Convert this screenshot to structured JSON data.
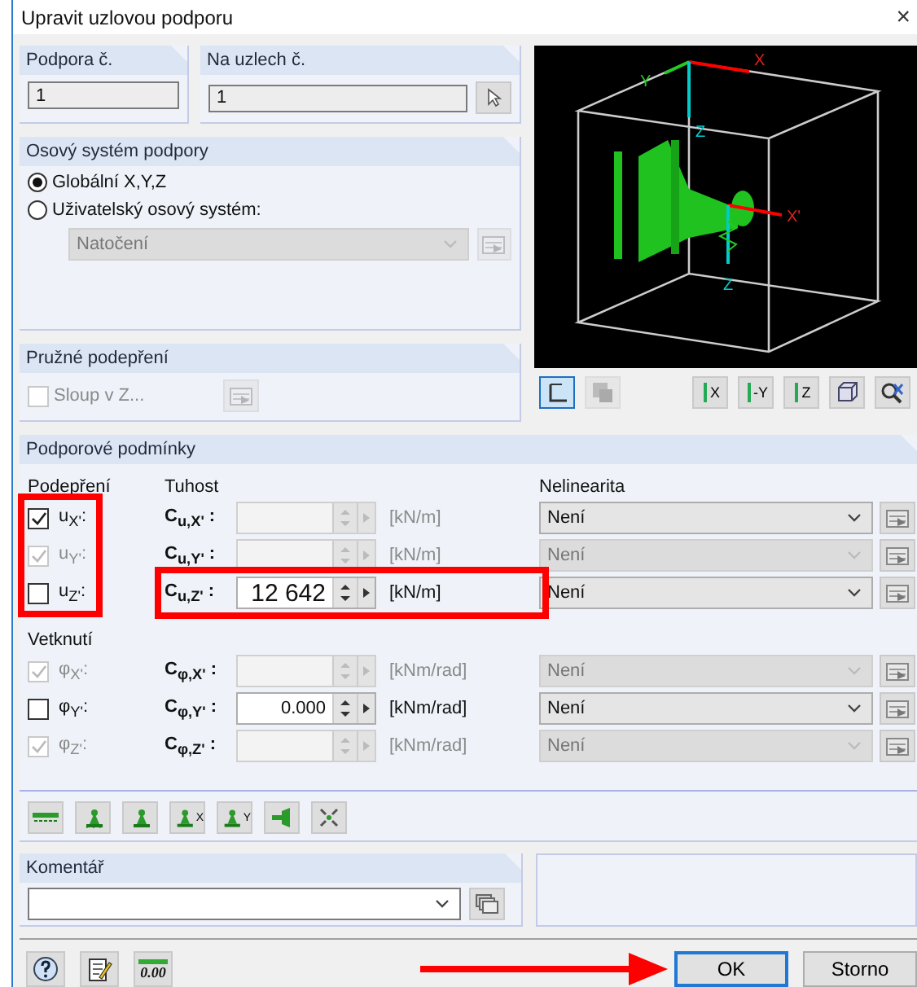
{
  "window": {
    "title": "Upravit uzlovou podporu",
    "close": "×"
  },
  "support_no": {
    "label": "Podpora č.",
    "value": "1"
  },
  "nodes": {
    "label": "Na uzlech č.",
    "value": "1"
  },
  "axis_system": {
    "title": "Osový systém podpory",
    "options": [
      {
        "label": "Globální X,Y,Z",
        "selected": true
      },
      {
        "label": "Uživatelský osový systém:",
        "selected": false
      }
    ],
    "rotation": {
      "value": "Natočení",
      "disabled": true
    }
  },
  "elastic": {
    "title": "Pružné podepření",
    "column": {
      "label": "Sloup v Z...",
      "checked": false,
      "disabled": true
    }
  },
  "preview": {
    "axis_labels": [
      "Y",
      "X",
      "Z",
      "X'",
      "Z"
    ]
  },
  "preview_tools": [
    {
      "kind": "axes",
      "selected": true,
      "disabled": false
    },
    {
      "kind": "render",
      "selected": false,
      "disabled": true
    },
    {
      "kind": "view",
      "label": "X",
      "selected": false,
      "disabled": false
    },
    {
      "kind": "view",
      "label": "-Y",
      "selected": false,
      "disabled": false
    },
    {
      "kind": "view",
      "label": "Z",
      "selected": false,
      "disabled": false
    },
    {
      "kind": "iso",
      "selected": false,
      "disabled": false
    },
    {
      "kind": "zoom",
      "selected": false,
      "disabled": false
    }
  ],
  "conditions": {
    "title": "Podporové podmínky",
    "support_header": "Podepření",
    "stiffness_header": "Tuhost",
    "nonlinearity_header": "Nelinearita",
    "rotation_header": "Vetknutí",
    "translations": [
      {
        "label": "u$_{X'}$:",
        "checked": true,
        "disabled": false,
        "stiffness_label": "C$_{u,X'}$ :",
        "unit": "[kN/m]",
        "stiffness_disabled": true,
        "nonlinearity": "Není",
        "nonlinearity_disabled": false,
        "highlighted": false
      },
      {
        "label": "u$_{Y'}$:",
        "checked": true,
        "disabled": true,
        "stiffness_label": "C$_{u,Y'}$ :",
        "unit": "[kN/m]",
        "stiffness_disabled": true,
        "nonlinearity": "Není",
        "nonlinearity_disabled": true,
        "highlighted": false
      },
      {
        "label": "u$_{Z'}$:",
        "checked": false,
        "disabled": false,
        "stiffness_label": "C$_{u,Z'}$ :",
        "value": "12 642",
        "unit": "[kN/m]",
        "stiffness_disabled": false,
        "nonlinearity": "Není",
        "nonlinearity_disabled": false,
        "highlighted": true
      }
    ],
    "rotations": [
      {
        "label": "φ$_{X'}$:",
        "checked": true,
        "disabled": true,
        "stiffness_label": "C$_{φ,X'}$ :",
        "unit": "[kNm/rad]",
        "stiffness_disabled": true,
        "nonlinearity": "Není",
        "nonlinearity_disabled": true,
        "highlighted": false
      },
      {
        "label": "φ$_{Y'}$:",
        "checked": false,
        "disabled": false,
        "stiffness_label": "C$_{φ,Y'}$ :",
        "value": "0.000",
        "unit": "[kNm/rad]",
        "stiffness_disabled": false,
        "nonlinearity": "Není",
        "nonlinearity_disabled": false,
        "highlighted": false
      },
      {
        "label": "φ$_{Z'}$:",
        "checked": true,
        "disabled": true,
        "stiffness_label": "C$_{φ,Z'}$ :",
        "unit": "[kNm/rad]",
        "stiffness_disabled": true,
        "nonlinearity": "Není",
        "nonlinearity_disabled": true,
        "highlighted": false
      }
    ],
    "tools": [
      {
        "kind": "line"
      },
      {
        "kind": "hinge"
      },
      {
        "kind": "fixed"
      },
      {
        "kind": "fixed",
        "label": "X"
      },
      {
        "kind": "fixed",
        "label": "Y"
      },
      {
        "kind": "roller"
      },
      {
        "kind": "free"
      }
    ]
  },
  "comment": {
    "title": "Komentář"
  },
  "bottom_tools": [
    {
      "kind": "help"
    },
    {
      "kind": "edit"
    },
    {
      "kind": "units",
      "label": "0.00"
    }
  ],
  "support_boxes_highlighted": true,
  "pointer_arrow": true,
  "buttons": [
    {
      "label": "OK",
      "default": true
    },
    {
      "label": "Storno",
      "default": false
    }
  ]
}
